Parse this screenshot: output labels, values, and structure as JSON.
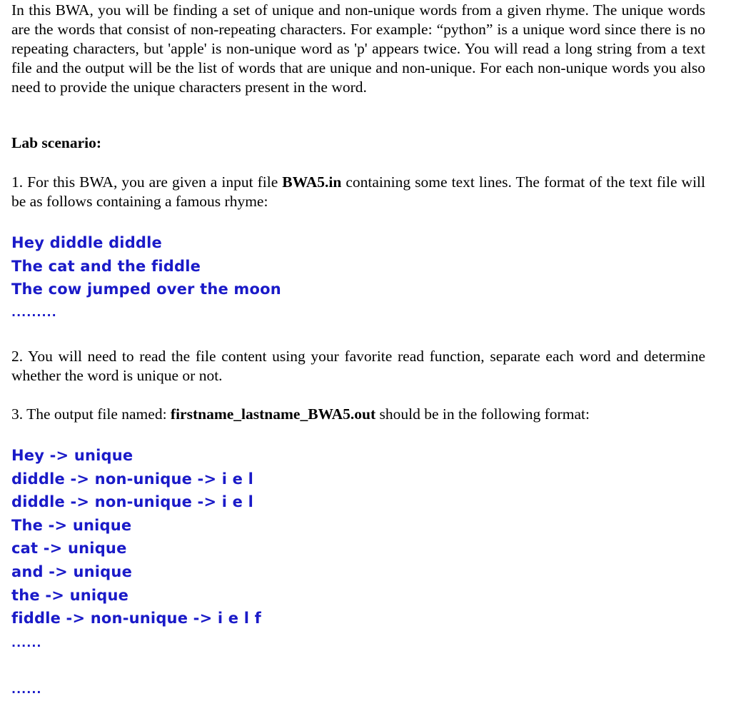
{
  "intro": "In this BWA, you will be finding a set of unique and non-unique words from a given rhyme. The unique words are the words that consist of non-repeating characters. For example: “python” is a unique word since there is no repeating characters, but 'apple' is non-unique word as 'p' appears twice. You will read a long string from a text file and the output will be the list of words that are unique and non-unique. For each non-unique words you also need to provide the unique characters present in the word.",
  "lab_heading": "Lab scenario:",
  "step1": {
    "before": "1. For this BWA, you are given a input file ",
    "filename": "BWA5.in",
    "after": " containing some text lines. The format of the text file will be as follows containing a famous rhyme:"
  },
  "rhyme_lines": [
    "Hey diddle diddle",
    "The cat and the fiddle",
    "The cow jumped over the moon"
  ],
  "rhyme_ellipsis": ".........",
  "step2": "2. You will need to read the file content using your favorite read function, separate each word and determine whether the word is unique or not.",
  "step3": {
    "before": "3. The output file named: ",
    "filename": "firstname_lastname_BWA5.out",
    "after": " should be in the following format:"
  },
  "output_lines": [
    "Hey -> unique",
    "diddle -> non-unique -> i e l",
    "diddle -> non-unique -> i e l",
    "The -> unique",
    "cat -> unique",
    "and -> unique",
    "the -> unique",
    "fiddle -> non-unique -> i e l f"
  ],
  "output_ellipsis_1": "......",
  "output_ellipsis_2": "......"
}
